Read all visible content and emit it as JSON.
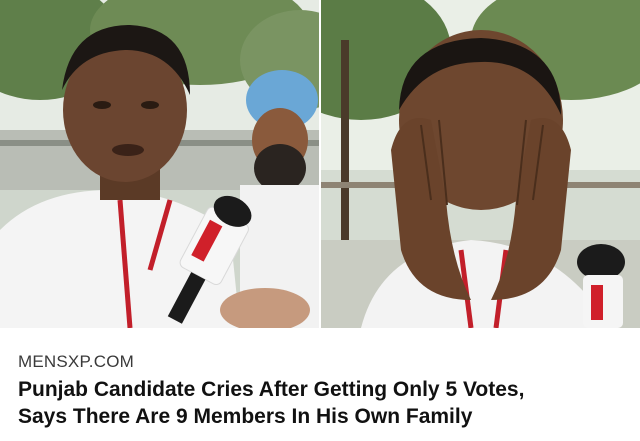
{
  "article": {
    "source": "MENSXP.COM",
    "headline_lines": [
      "Punjab Candidate Cries After Getting Only 5 Votes,",
      "Says There Are 9 Members In His Own Family"
    ]
  },
  "photos": {
    "left": {
      "subject": "news-photo-candidate-speaking"
    },
    "right": {
      "subject": "news-photo-candidate-crying"
    }
  },
  "colors": {
    "background": "#ffffff",
    "source_text": "#3a3a3a",
    "headline_text": "#111111",
    "microphone_red": "#d0202a"
  }
}
